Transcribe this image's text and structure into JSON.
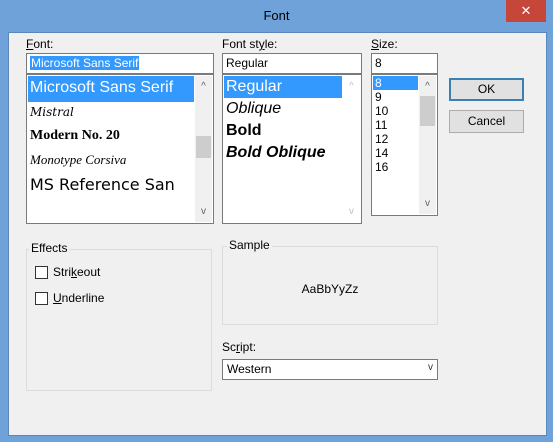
{
  "window": {
    "title": "Font",
    "close_glyph": "✕"
  },
  "font": {
    "label_prefix": "",
    "label_u": "F",
    "label_rest": "ont:",
    "value": "Microsoft Sans Serif",
    "items": [
      {
        "label": "Microsoft Sans Serif",
        "selected": true
      },
      {
        "label": "Mistral"
      },
      {
        "label": "Modern No. 20"
      },
      {
        "label": "Monotype Corsiva"
      },
      {
        "label": "MS Reference San"
      }
    ]
  },
  "style": {
    "label_prefix": "Font st",
    "label_u": "y",
    "label_rest": "le:",
    "value": "Regular",
    "items": [
      {
        "label": "Regular",
        "selected": true
      },
      {
        "label": "Oblique"
      },
      {
        "label": "Bold"
      },
      {
        "label": "Bold Oblique"
      }
    ]
  },
  "size": {
    "label_prefix": "",
    "label_u": "S",
    "label_rest": "ize:",
    "value": "8",
    "items": [
      {
        "label": "8",
        "selected": true
      },
      {
        "label": "9"
      },
      {
        "label": "10"
      },
      {
        "label": "11"
      },
      {
        "label": "12"
      },
      {
        "label": "14"
      },
      {
        "label": "16"
      }
    ]
  },
  "buttons": {
    "ok": "OK",
    "cancel": "Cancel"
  },
  "effects": {
    "title": "Effects",
    "strikeout_pre": "Stri",
    "strikeout_u": "k",
    "strikeout_post": "eout",
    "underline_pre": "",
    "underline_u": "U",
    "underline_post": "nderline"
  },
  "sample": {
    "title": "Sample",
    "text": "AaBbYyZz"
  },
  "script": {
    "label_pre": "Sc",
    "label_u": "r",
    "label_post": "ipt:",
    "value": "Western"
  },
  "icons": {
    "scroll_up": "^",
    "scroll_down": "v",
    "dropdown": "v"
  },
  "colors": {
    "selection": "#3399ff",
    "titlebar": "#6fa2d9",
    "close": "#c7463a"
  }
}
